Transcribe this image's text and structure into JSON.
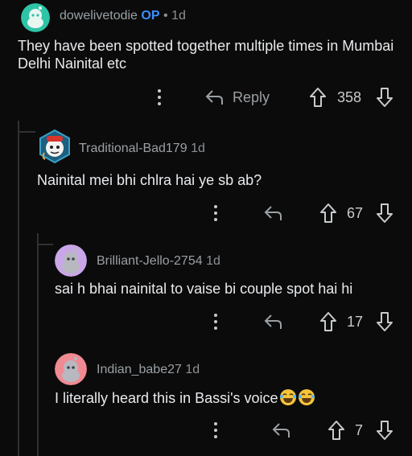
{
  "comments": [
    {
      "username": "dowelivetodie",
      "op_badge": "OP",
      "separator": "•",
      "age": "1d",
      "text": "They have been spotted together multiple times in Mumbai Delhi Nainital etc",
      "reply_label": "Reply",
      "votes": "358",
      "avatar_color": "#2ec4a6"
    },
    {
      "username": "Traditional-Bad179",
      "age": "1d",
      "text": "Nainital mei bhi chlra hai ye sb ab?",
      "votes": "67",
      "avatar_color": "#2a7fa8"
    },
    {
      "username": "Brilliant-Jello-2754",
      "age": "1d",
      "text": "sai h bhai nainital to vaise bi couple spot hai hi",
      "votes": "17",
      "avatar_color": "#c9a6e8"
    },
    {
      "username": "Indian_babe27",
      "age": "1d",
      "text": "I literally heard this in Bassi's voice",
      "emoji_count": 2,
      "votes": "7",
      "avatar_color": "#f08a93"
    }
  ],
  "colors": {
    "background": "#0b0b0b",
    "op_badge": "#3d8eff",
    "thread_line": "#2f3133"
  }
}
